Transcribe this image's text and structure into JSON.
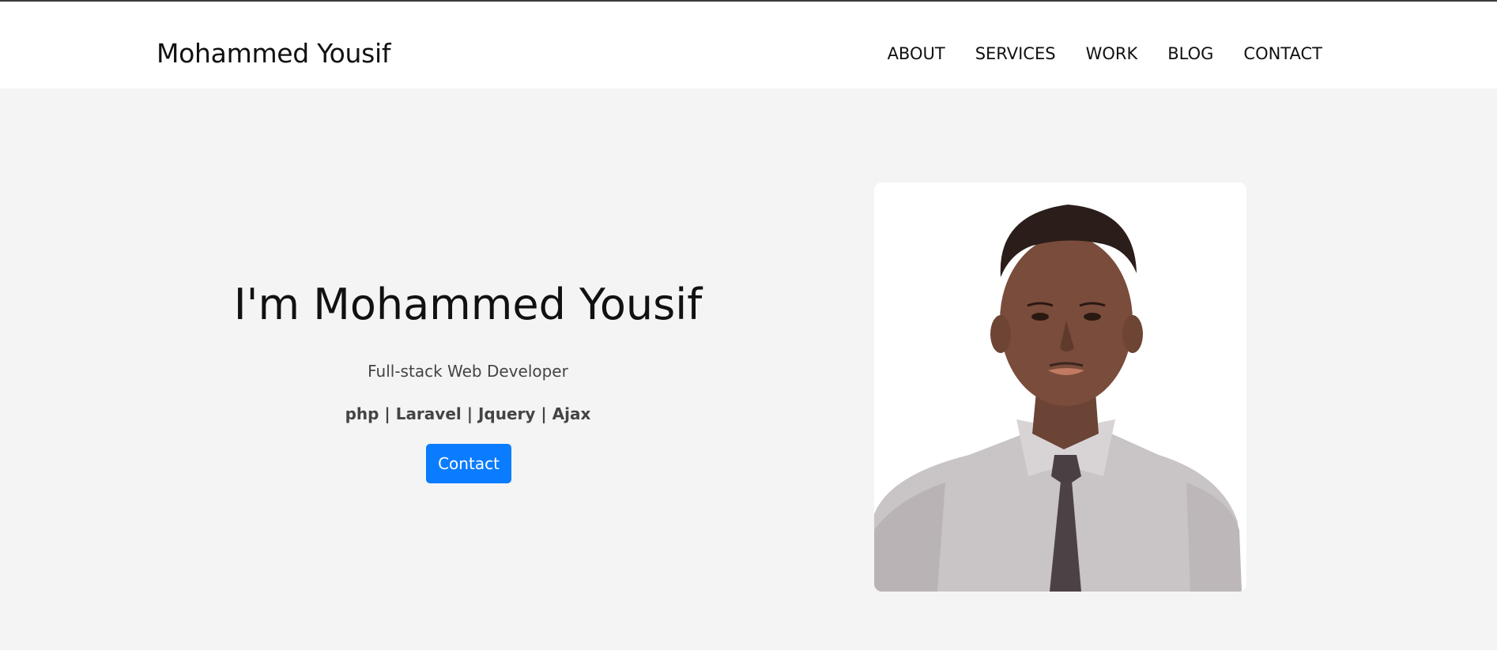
{
  "header": {
    "brand": "Mohammed Yousif",
    "nav": [
      "ABOUT",
      "SERVICES",
      "WORK",
      "BLOG",
      "CONTACT"
    ]
  },
  "hero": {
    "title": "I'm Mohammed Yousif",
    "subtitle": "Full-stack Web Developer",
    "skills": "php | Laravel | Jquery | Ajax",
    "cta_label": "Contact"
  },
  "colors": {
    "accent": "#0a7cff",
    "page_background": "#f4f4f4",
    "header_background": "#ffffff"
  }
}
